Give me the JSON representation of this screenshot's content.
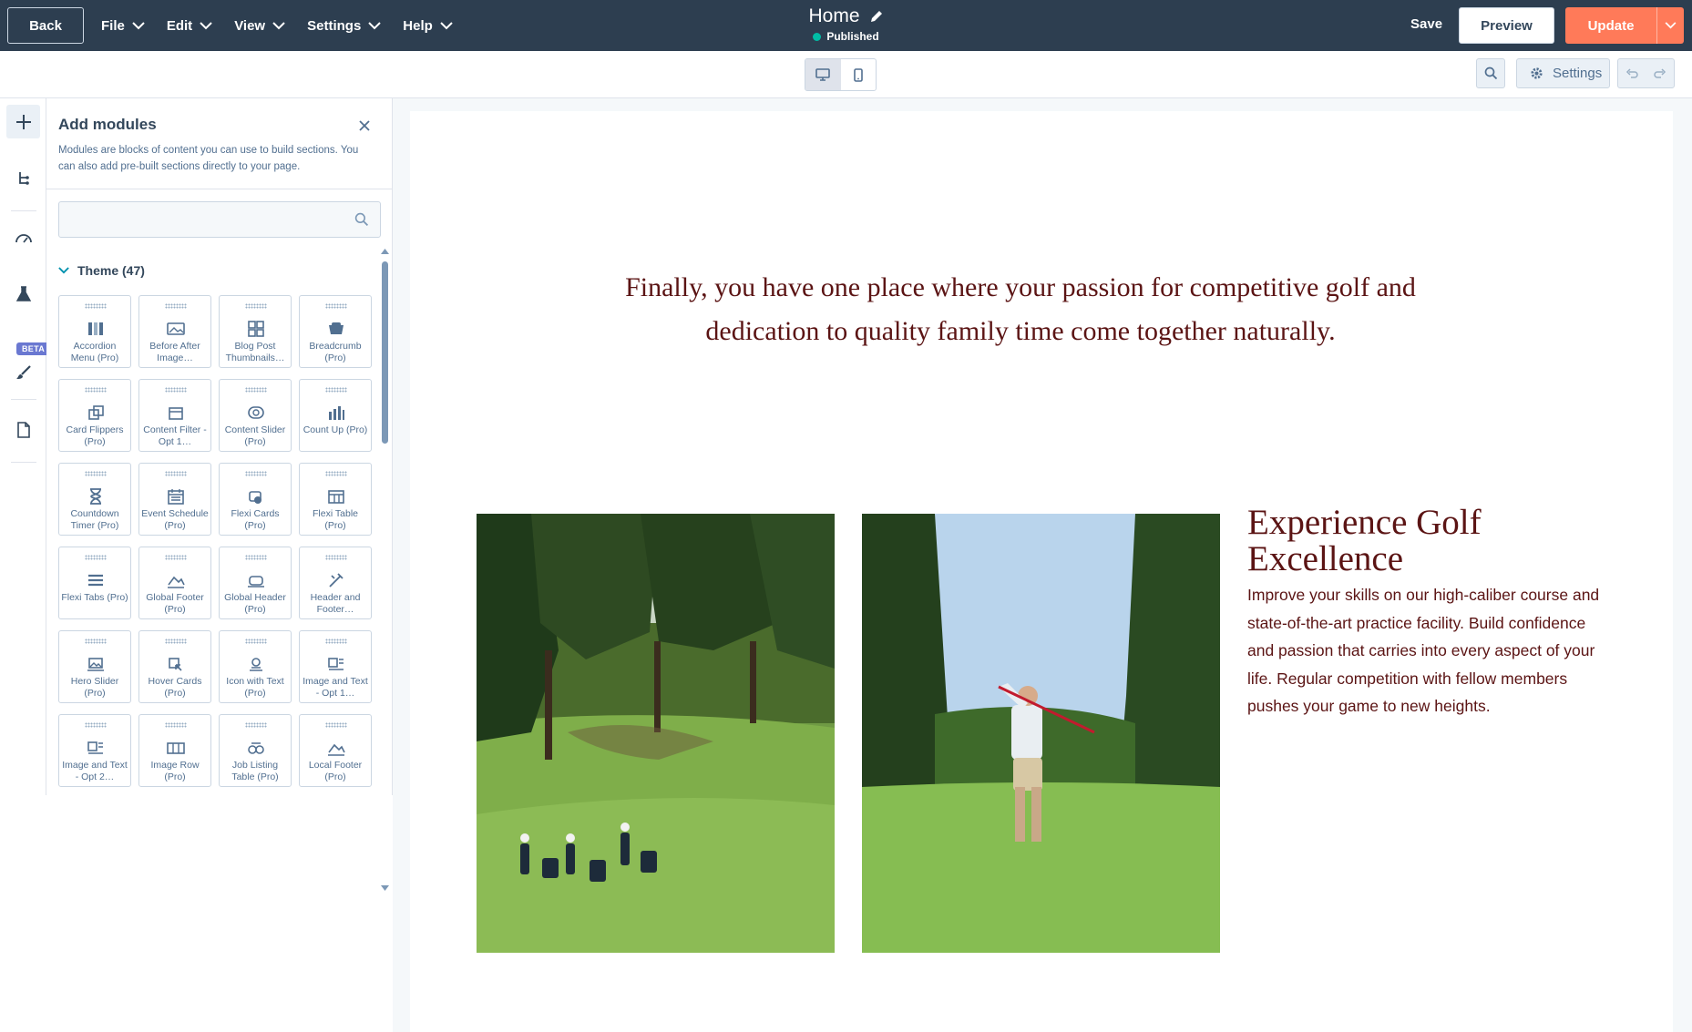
{
  "topbar": {
    "back_label": "Back",
    "menus": [
      "File",
      "Edit",
      "View",
      "Settings",
      "Help"
    ],
    "page_title": "Home",
    "status": "Published",
    "save_label": "Save",
    "preview_label": "Preview",
    "update_label": "Update"
  },
  "subbar": {
    "settings_label": "Settings",
    "device_active": "desktop"
  },
  "rail": {
    "beta_label": "BETA",
    "items": [
      "add-icon",
      "tree-icon",
      "speedometer-icon",
      "flask-icon",
      "brush-icon",
      "document-icon"
    ]
  },
  "panel": {
    "title": "Add modules",
    "description": "Modules are blocks of content you can use to build sections. You can also add pre-built sections directly to your page.",
    "search_placeholder": "",
    "section_label": "Theme (47)",
    "modules": [
      {
        "label": "Accordion Menu (Pro)",
        "icon": "accordion-icon"
      },
      {
        "label": "Before After Image…",
        "icon": "image-compare-icon"
      },
      {
        "label": "Blog Post Thumbnails…",
        "icon": "grid-icon"
      },
      {
        "label": "Breadcrumb (Pro)",
        "icon": "breadcrumb-icon"
      },
      {
        "label": "Card Flippers (Pro)",
        "icon": "card-flip-icon"
      },
      {
        "label": "Content Filter - Opt 1…",
        "icon": "filter-icon"
      },
      {
        "label": "Content Slider (Pro)",
        "icon": "slider-icon"
      },
      {
        "label": "Count Up (Pro)",
        "icon": "bar-chart-icon"
      },
      {
        "label": "Countdown Timer (Pro)",
        "icon": "hourglass-icon"
      },
      {
        "label": "Event Schedule (Pro)",
        "icon": "calendar-icon"
      },
      {
        "label": "Flexi Cards (Pro)",
        "icon": "flexi-cards-icon"
      },
      {
        "label": "Flexi Table (Pro)",
        "icon": "table-icon"
      },
      {
        "label": "Flexi Tabs (Pro)",
        "icon": "tabs-icon"
      },
      {
        "label": "Global Footer (Pro)",
        "icon": "footer-icon"
      },
      {
        "label": "Global Header (Pro)",
        "icon": "header-icon"
      },
      {
        "label": "Header and Footer…",
        "icon": "tools-icon"
      },
      {
        "label": "Hero Slider (Pro)",
        "icon": "hero-slider-icon"
      },
      {
        "label": "Hover Cards (Pro)",
        "icon": "hover-cards-icon"
      },
      {
        "label": "Icon with Text (Pro)",
        "icon": "icon-text-icon"
      },
      {
        "label": "Image and Text - Opt 1…",
        "icon": "image-text-icon"
      },
      {
        "label": "Image and Text - Opt 2…",
        "icon": "image-text-icon"
      },
      {
        "label": "Image Row (Pro)",
        "icon": "image-row-icon"
      },
      {
        "label": "Job Listing Table (Pro)",
        "icon": "job-listing-icon"
      },
      {
        "label": "Local Footer (Pro)",
        "icon": "footer-icon"
      }
    ]
  },
  "page": {
    "tagline": "Finally, you have one place where your passion for competitive golf and dedication to quality family time come together naturally.",
    "heading": "Experience Golf Excellence",
    "body": "Improve your skills on our high-caliber course and state-of-the-art practice facility. Build confidence and passion that carries into every aspect of your life. Regular competition with fellow members pushes your game to new heights."
  },
  "colors": {
    "topbar": "#2d3e50",
    "accent_orange": "#ff7a59",
    "published_dot": "#00bda5",
    "page_text": "#5b1414",
    "beta": "#6a78d1"
  }
}
